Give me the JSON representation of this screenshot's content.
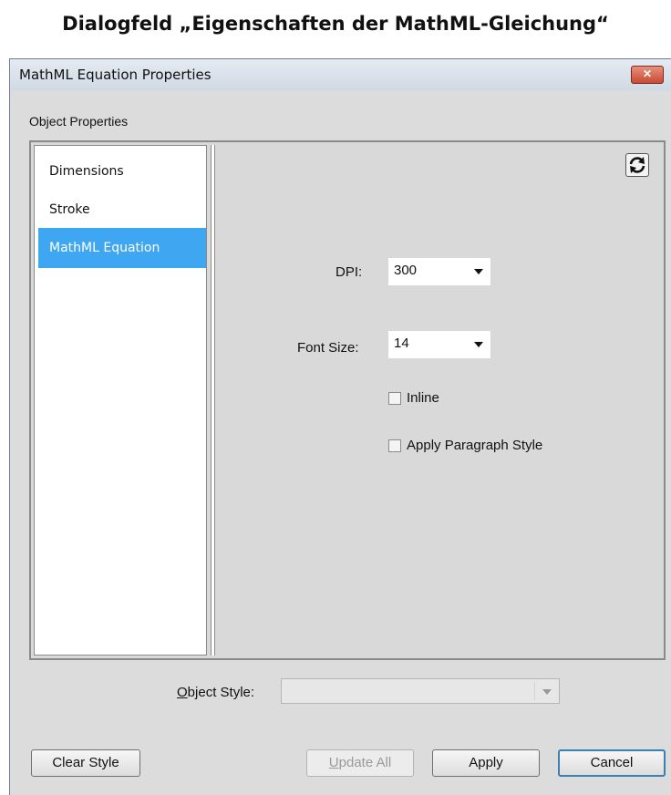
{
  "caption": "Dialogfeld „Eigenschaften der MathML-Gleichung“",
  "window": {
    "title": "MathML Equation Properties",
    "close_glyph": "✕"
  },
  "group_label": "Object Properties",
  "nav": {
    "items": [
      {
        "label": "Dimensions",
        "selected": false
      },
      {
        "label": "Stroke",
        "selected": false
      },
      {
        "label": "MathML Equation",
        "selected": true
      }
    ]
  },
  "form": {
    "dpi": {
      "label": "DPI:",
      "value": "300"
    },
    "font_size": {
      "label": "Font Size:",
      "value": "14"
    },
    "inline": {
      "label": "Inline",
      "checked": false
    },
    "apply_paragraph_style": {
      "label": "Apply Paragraph Style",
      "checked": false
    }
  },
  "object_style": {
    "label_accel": "O",
    "label_rest": "bject Style:",
    "value": ""
  },
  "buttons": {
    "clear_style": "Clear Style",
    "update_all_accel": "U",
    "update_all_rest": "pdate All",
    "apply": "Apply",
    "cancel": "Cancel"
  },
  "colors": {
    "selection": "#3fa6f2",
    "close_button": "#c84a32",
    "default_button_border": "#3c7fb1"
  }
}
